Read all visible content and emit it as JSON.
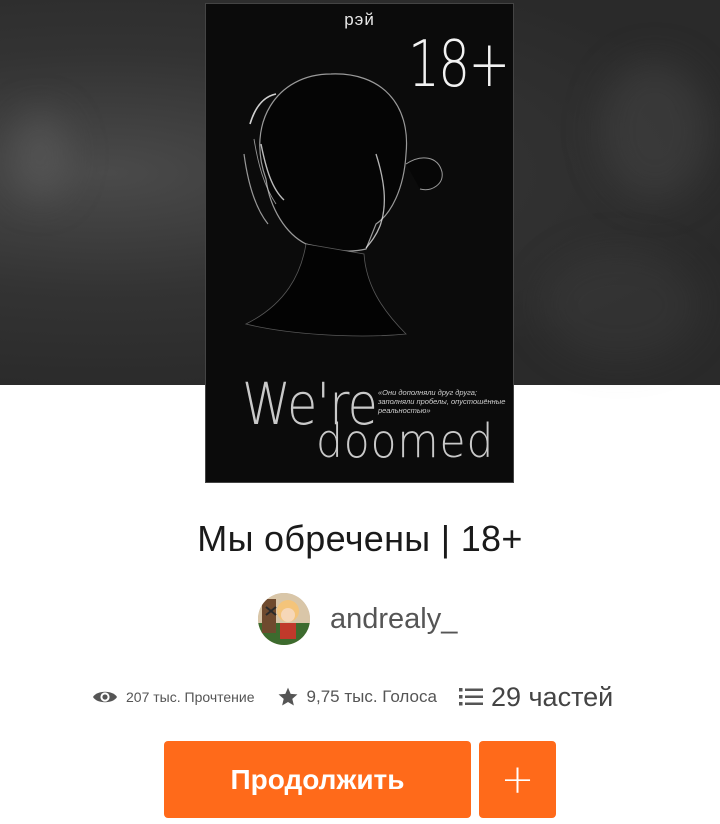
{
  "cover": {
    "author_text": "рэй",
    "age_text": "18+",
    "title_line_1": "We're",
    "title_line_2": "doomed",
    "quote": "«Они дополняли друг друга; заполняли пробелы, опустошённые реальностью»"
  },
  "story": {
    "title": "Мы обречены | 18+"
  },
  "author": {
    "name": "andrealy_"
  },
  "stats": {
    "reads": "207 тыс. Прочтение",
    "votes": "9,75 тыс. Голоса",
    "parts": "29 частей"
  },
  "actions": {
    "continue_label": "Продолжить",
    "add_label": "+"
  },
  "colors": {
    "accent": "#ff6a1a",
    "header_bg": "#2d2d2d"
  },
  "icons": {
    "reads": "eye-icon",
    "votes": "star-icon",
    "parts": "list-icon"
  }
}
